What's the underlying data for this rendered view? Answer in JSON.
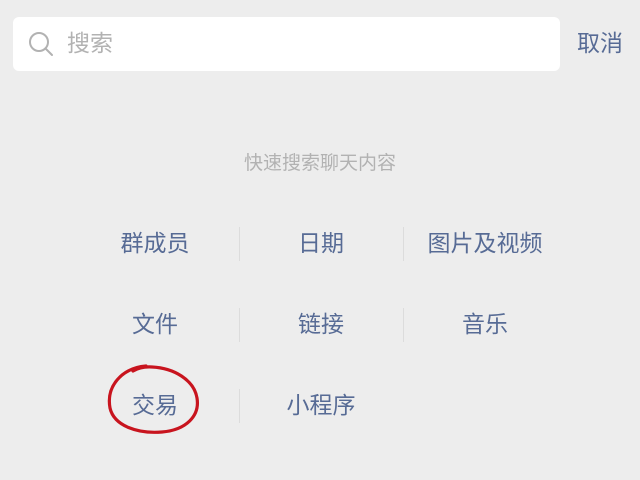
{
  "search": {
    "placeholder": "搜索",
    "value": ""
  },
  "cancel_label": "取消",
  "hint": "快速搜索聊天内容",
  "categories": [
    {
      "label": "群成员"
    },
    {
      "label": "日期"
    },
    {
      "label": "图片及视频"
    },
    {
      "label": "文件"
    },
    {
      "label": "链接"
    },
    {
      "label": "音乐"
    },
    {
      "label": "交易"
    },
    {
      "label": "小程序"
    }
  ],
  "colors": {
    "background": "#ededed",
    "link": "#576b95",
    "hint": "#b2b2b2",
    "annotation": "#c8141e"
  }
}
